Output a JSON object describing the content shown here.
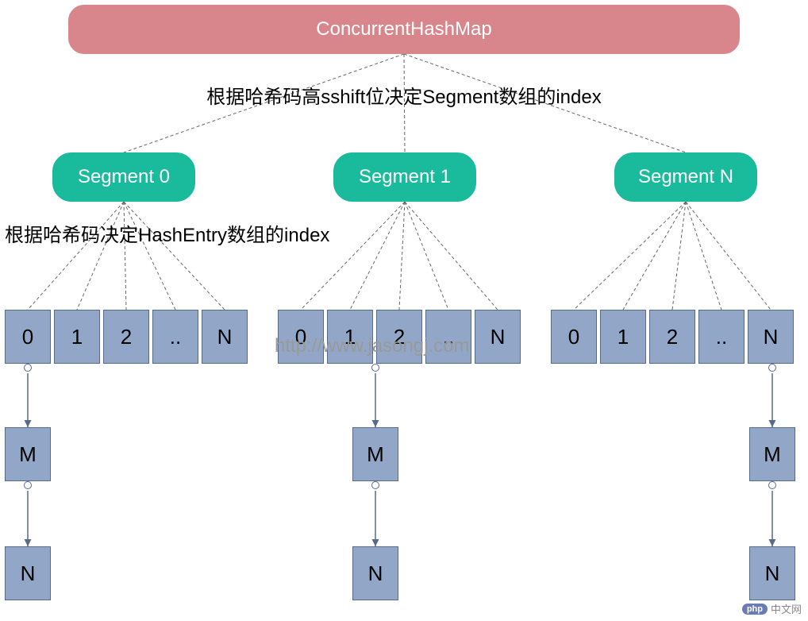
{
  "root": {
    "title": "ConcurrentHashMap"
  },
  "labels": {
    "segment_rule": "根据哈希码高sshift位决定Segment数组的index",
    "entry_rule": "根据哈希码决定HashEntry数组的index",
    "watermark": "http://www.jasongj.com"
  },
  "segments": [
    {
      "label": "Segment 0"
    },
    {
      "label": "Segment 1"
    },
    {
      "label": "Segment N"
    }
  ],
  "array_cells": [
    "0",
    "1",
    "2",
    "..",
    "N"
  ],
  "chain_nodes": {
    "first": "M",
    "second": "N"
  },
  "footer": {
    "php": "php",
    "text": "中文网"
  },
  "chart_data": {
    "type": "diagram",
    "description": "ConcurrentHashMap (Java 7) structure: top-level map divides into Segment array; each Segment holds a HashEntry array; each HashEntry bucket is a linked list of nodes.",
    "levels": [
      {
        "name": "ConcurrentHashMap",
        "count": 1
      },
      {
        "name": "Segment[]",
        "index_rule": "high sshift bits of hash code",
        "shown": [
          "Segment 0",
          "Segment 1",
          "Segment N"
        ]
      },
      {
        "name": "HashEntry[] per Segment",
        "index_rule": "hash code",
        "cells_shown": [
          "0",
          "1",
          "2",
          "..",
          "N"
        ]
      },
      {
        "name": "Linked list per bucket",
        "nodes_shown": [
          "M",
          "N"
        ]
      }
    ]
  }
}
